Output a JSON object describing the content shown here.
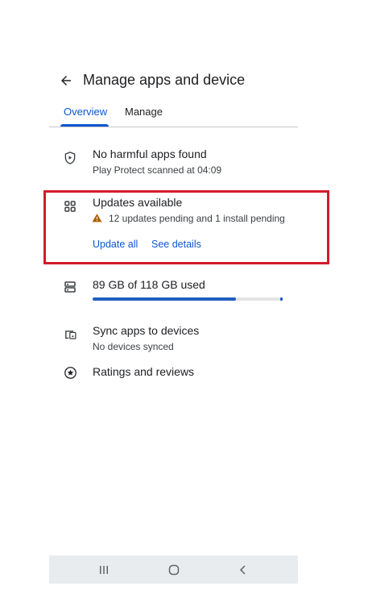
{
  "header": {
    "title": "Manage apps and device",
    "back_icon": "arrow-back-icon"
  },
  "tabs": [
    {
      "label": "Overview",
      "selected": true
    },
    {
      "label": "Manage",
      "selected": false
    }
  ],
  "play_protect": {
    "title": "No harmful apps found",
    "subtitle": "Play Protect scanned at 04:09",
    "icon": "shield-icon"
  },
  "updates": {
    "title": "Updates available",
    "subtitle": "12 updates pending and 1 install pending",
    "icon": "apps-grid-icon",
    "warning_icon": "warning-icon",
    "update_all_label": "Update all",
    "see_details_label": "See details"
  },
  "storage": {
    "title": "89 GB of 118 GB used",
    "used_fraction": 0.754,
    "icon": "storage-icon"
  },
  "sync": {
    "title": "Sync apps to devices",
    "subtitle": "No devices synced",
    "icon": "devices-icon"
  },
  "ratings": {
    "title": "Ratings and reviews",
    "icon": "star-circle-icon"
  },
  "colors": {
    "accent": "#0b57d0",
    "highlight": "#d11b2b",
    "warning": "#b06000"
  },
  "navbar": {
    "icons": [
      "recents-icon",
      "home-icon",
      "back-icon"
    ]
  }
}
